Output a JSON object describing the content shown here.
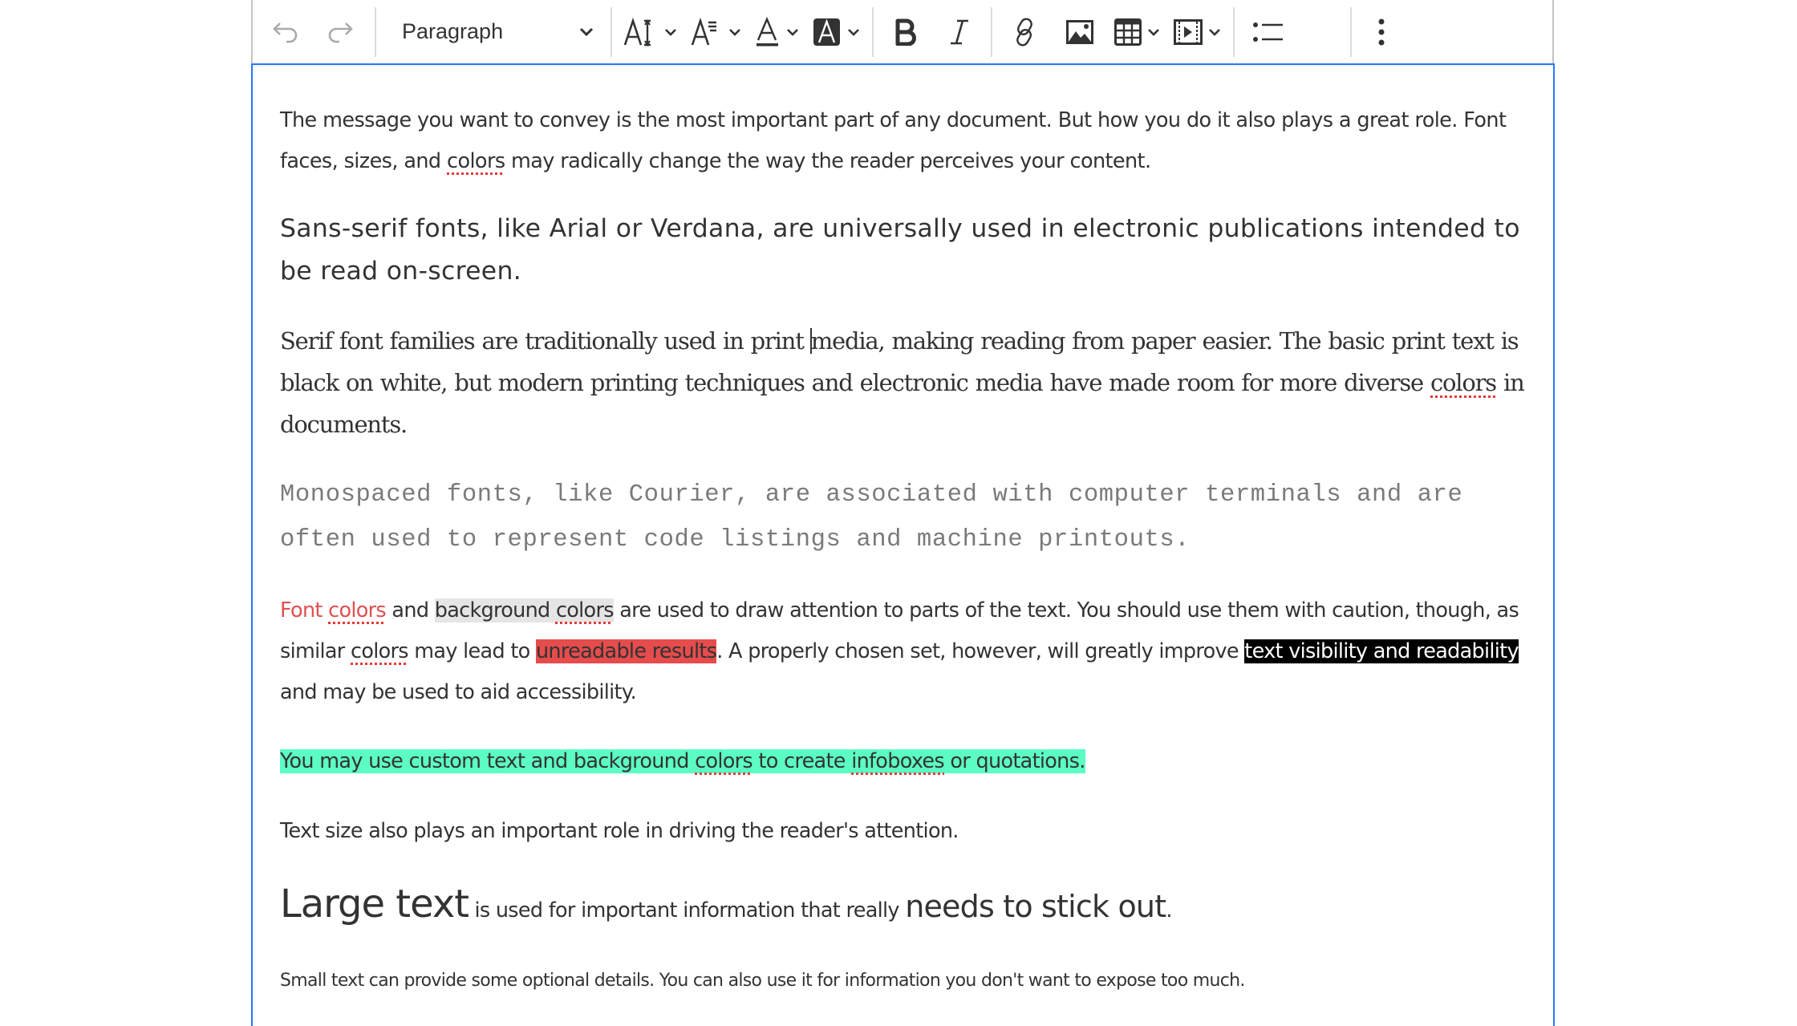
{
  "toolbar": {
    "undo": "undo",
    "redo": "redo",
    "heading_select": "Paragraph",
    "font_size": "font-size",
    "font_family": "font-family",
    "font_color": "font-color",
    "font_background_color": "font-background-color",
    "bold": "bold",
    "italic": "italic",
    "link": "link",
    "image": "insert-image",
    "table": "insert-table",
    "media": "insert-media",
    "bulleted_list": "bulleted-list",
    "more": "show-more-items"
  },
  "content": {
    "p1": {
      "a": "The message you want to convey is the most important part of any document. But how you do it also plays a great role. Font faces, sizes, and ",
      "colors": "colors",
      "b": " may radically change the way the reader perceives your content."
    },
    "p2": "Sans-serif fonts, like Arial or Verdana, are universally used in electronic publications intended to be read on-screen.",
    "p3": {
      "a": "Serif font families are traditionally used in print ",
      "b": "media, making reading from paper easier. The basic print text is black on white, but modern printing techniques and electronic media have made room for more diverse ",
      "colors": "colors",
      "c": " in documents."
    },
    "p4": "Monospaced fonts, like Courier, are associated with computer terminals and are often used to represent code listings and machine printouts.",
    "p5": {
      "font_red": "Font ",
      "font_red_colors": "colors",
      "and": " and ",
      "bg_grey": "background ",
      "bg_grey_colors": "colors",
      "a": " are used to draw attention to parts of the text. You should use them with caution, though, as similar ",
      "colors": "colors",
      "b": " may lead to ",
      "red_bg": "unreadable results",
      "c": ". A properly chosen set, however, will greatly improve ",
      "black_bg": "text visibility and readability",
      "d": " and may be used to aid accessibility."
    },
    "p6": {
      "a": "You may use custom text and background ",
      "colors": "colors",
      "b": " to create ",
      "infoboxes": "infoboxes",
      "c": " or quotations."
    },
    "p7": "Text size also plays an important role in driving the reader's attention.",
    "p8": {
      "large": "Large text",
      "a": " is used for important information that really ",
      "medium": "needs to stick out",
      "b": "."
    },
    "p9": "Small text can provide some optional details. You can also use it for information you don't want to expose too much."
  },
  "colors": {
    "focus_border": "#2977ff",
    "font_red": "#e05050",
    "grey_bg": "#e5e5e5",
    "red_bg": "#e64c4c",
    "black_bg": "#000000",
    "green_bg": "#5cfdc3",
    "mono_text": "#7a7a7a"
  }
}
